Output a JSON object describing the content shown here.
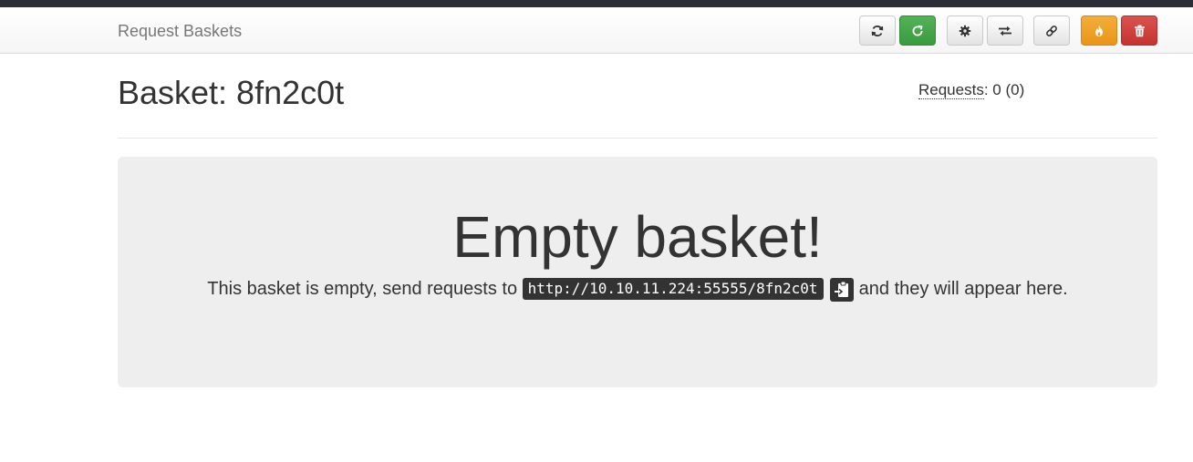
{
  "navbar": {
    "brand": "Request Baskets",
    "buttons": [
      {
        "name": "refresh-button",
        "icon": "refresh-icon"
      },
      {
        "name": "auto-refresh-button",
        "icon": "rotate-right-icon"
      },
      {
        "name": "settings-button",
        "icon": "gear-icon"
      },
      {
        "name": "responses-button",
        "icon": "transfer-icon"
      },
      {
        "name": "share-link-button",
        "icon": "link-icon"
      },
      {
        "name": "clear-basket-button",
        "icon": "fire-icon"
      },
      {
        "name": "delete-basket-button",
        "icon": "trash-icon"
      }
    ],
    "colors": {
      "success": "#47a447",
      "warning": "#f0ad4e",
      "danger": "#d9534f"
    }
  },
  "page": {
    "title": "Basket: 8fn2c0t",
    "requests_label": "Requests",
    "requests_count": ": 0 (0)"
  },
  "empty": {
    "heading": "Empty basket!",
    "text_before": "This basket is empty, send requests to ",
    "url": "http://10.10.11.224:55555/8fn2c0t",
    "copy_icon": "clipboard-icon",
    "text_after": " and they will appear here."
  }
}
